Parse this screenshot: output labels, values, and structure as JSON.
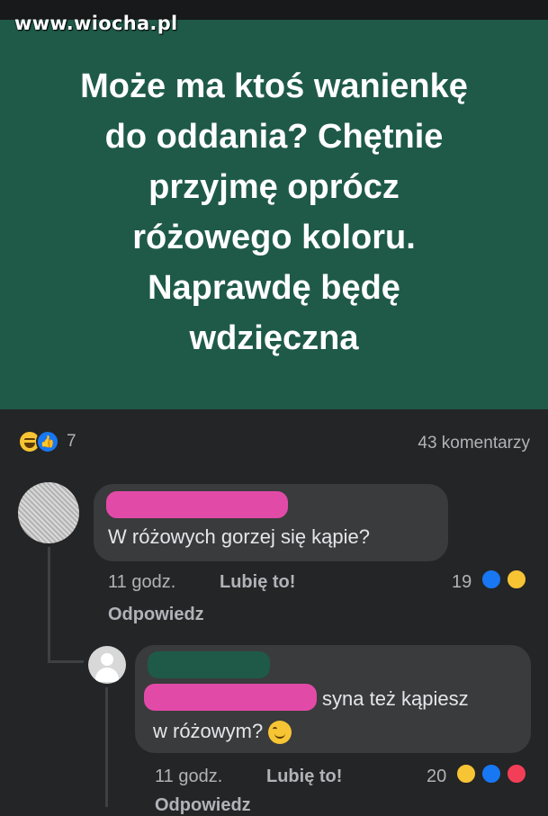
{
  "watermark": "www.wiocha.pl",
  "post": {
    "text_lines": [
      "Może ma ktoś wanienkę",
      "do oddania? Chętnie",
      "przyjmę oprócz",
      "różowego koloru.",
      "Naprawdę będę",
      "wdzięczna"
    ],
    "background_color": "#1f5a48"
  },
  "reactions": {
    "count": "7",
    "icons": [
      "haha-icon",
      "like-icon"
    ]
  },
  "comments_count": "43 komentarzy",
  "comments": [
    {
      "text": "W różowych gorzej się kąpie?",
      "time": "11 godz.",
      "like_label": "Lubię to!",
      "reply_label": "Odpowiedz",
      "reaction_count": "19",
      "reaction_icons": [
        "like-icon",
        "haha-icon"
      ]
    },
    {
      "text_line1": "syna też kąpiesz",
      "text_line2": "w różowym?",
      "emoji": "smiling-face-icon",
      "time": "11 godz.",
      "like_label": "Lubię to!",
      "reply_label": "Odpowiedz",
      "reaction_count": "20",
      "reaction_icons": [
        "haha-icon",
        "like-icon",
        "love-icon"
      ]
    }
  ],
  "colors": {
    "background": "#242526",
    "bubble": "#3a3b3c",
    "redaction_pink": "#e24aa8",
    "like_blue": "#1877f2",
    "love_red": "#f33e58"
  }
}
